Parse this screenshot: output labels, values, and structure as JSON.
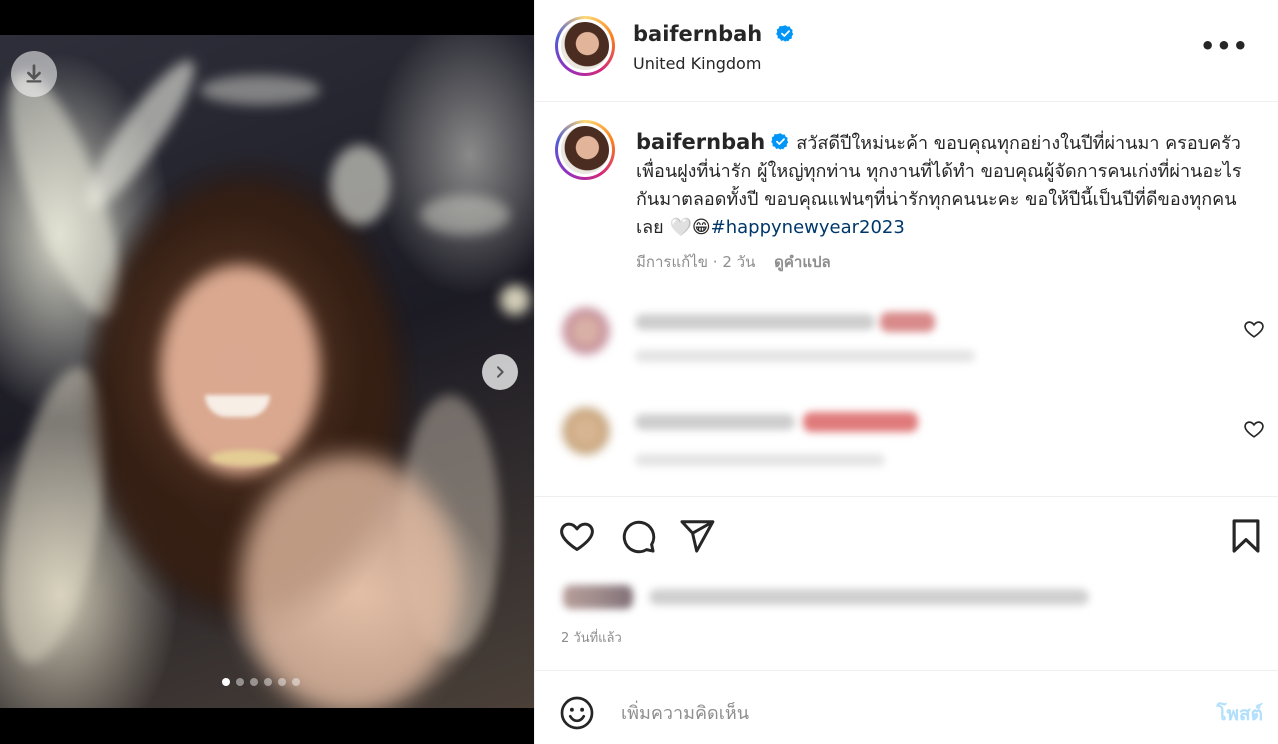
{
  "icons": {
    "download": "download-icon",
    "next": "chevron-right-icon",
    "verified": "verified-badge-icon",
    "more": "more-options-icon",
    "like": "heart-icon",
    "comment": "comment-icon",
    "share": "send-icon",
    "save": "bookmark-icon",
    "emoji": "emoji-icon"
  },
  "colors": {
    "link": "#00376b",
    "verified": "#0095f6",
    "muted": "#8e8e8e",
    "post_button": "#b2dffc"
  },
  "carousel": {
    "total_slides": 6,
    "active_slide": 1
  },
  "header": {
    "username": "baifernbah",
    "location": "United Kingdom",
    "more_label": "•••"
  },
  "caption": {
    "username": "baifernbah",
    "text": "สวัสดีปีใหม่นะค้า ขอบคุณทุกอย่างในปีที่ผ่านมา ครอบครัว เพื่อนฝูงที่น่ารัก ผู้ใหญ่ทุกท่าน ทุกงานที่ได้ทำ ขอบคุณผู้จัดการคนเก่งที่ผ่านอะไรกันมาตลอดทั้งปี ขอบคุณแฟนๆที่น่ารักทุกคนนะคะ ขอให้ปีนี้เป็นปีที่ดีของทุกคนเลย 🤍😁",
    "hashtag": "#happynewyear2023",
    "edited": "มีการแก้ไข",
    "time": "2 วัน",
    "separator": "·",
    "translate": "ดูคำแปล"
  },
  "post": {
    "time": "2 วันที่แล้ว"
  },
  "comment_box": {
    "placeholder": "เพิ่มความคิดเห็น",
    "post_label": "โพสต์"
  }
}
